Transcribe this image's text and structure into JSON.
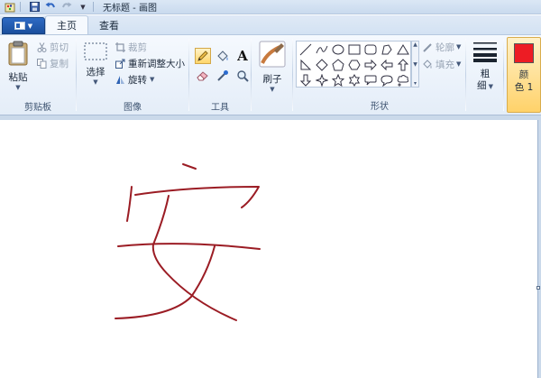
{
  "titlebar": {
    "title": "无标题 - 画图",
    "icons": [
      "paint-app-icon",
      "save-icon",
      "undo-icon",
      "redo-icon",
      "customize-dropdown-icon"
    ]
  },
  "tabs": [
    {
      "label": "主页",
      "active": true
    },
    {
      "label": "查看",
      "active": false
    }
  ],
  "clipboard": {
    "paste_label": "粘贴",
    "cut_label": "剪切",
    "copy_label": "复制",
    "group_label": "剪贴板"
  },
  "image": {
    "select_label": "选择",
    "crop_label": "裁剪",
    "resize_label": "重新调整大小",
    "rotate_label": "旋转",
    "group_label": "图像"
  },
  "tools": {
    "group_label": "工具",
    "items": [
      "pencil-icon",
      "fill-icon",
      "text-icon",
      "eraser-icon",
      "color-picker-icon",
      "magnifier-icon"
    ],
    "selected": "pencil-icon",
    "text_glyph": "A"
  },
  "brushes": {
    "label": "刷子"
  },
  "shapes": {
    "group_label": "形状",
    "outline_label": "轮廓",
    "fill_label": "填充"
  },
  "size": {
    "label_line1": "粗",
    "label_line2": "细"
  },
  "color1": {
    "label_line1": "颜",
    "label_line2": "色 1",
    "value": "#ed1c24"
  },
  "drawing": {
    "stroke_color": "#9b1c24"
  }
}
